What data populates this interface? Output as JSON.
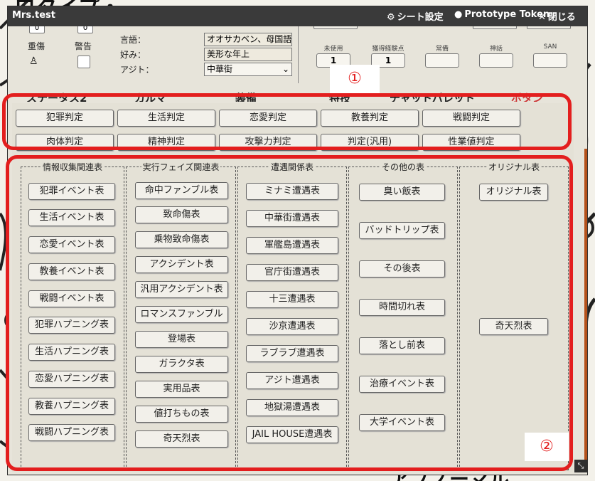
{
  "background": {
    "top_text": "ロタイプ・",
    "bottom_text": "アブノーマル"
  },
  "window": {
    "title": "Mrs.test",
    "sheet_settings_label": "シート設定",
    "prototype_token_label": "Prototype Token",
    "close_label": "閉じる"
  },
  "info": {
    "counter_value_1": "0",
    "counter_value_2": "0",
    "label_injury": "重傷",
    "label_warning": "警告",
    "language_label": "言語：",
    "language_value": "オオサカベン、母国語",
    "likes_label": "好み：",
    "likes_value": "美形な年上",
    "hideout_label": "アジト：",
    "hideout_value": "中華街",
    "stats": [
      {
        "label": "未使用",
        "value": "1"
      },
      {
        "label": "獲得経験点",
        "value": "1"
      },
      {
        "label": "常備",
        "value": ""
      },
      {
        "label": "神話",
        "value": ""
      },
      {
        "label": "SAN",
        "value": ""
      }
    ]
  },
  "tabs": [
    "ステータス2",
    "カルマ",
    "装備",
    "特技",
    "チャットパレット",
    "ボタン"
  ],
  "markers": {
    "one": "①",
    "two": "②"
  },
  "judgments": {
    "row1": [
      "犯罪判定",
      "生活判定",
      "恋愛判定",
      "教養判定",
      "戦闘判定"
    ],
    "row2": [
      "肉体判定",
      "精神判定",
      "攻撃力判定",
      "判定(汎用)",
      "性業値判定"
    ]
  },
  "tables": {
    "columns": [
      {
        "title": "情報収集関連表",
        "items": [
          "犯罪イベント表",
          "生活イベント表",
          "恋愛イベント表",
          "教養イベント表",
          "戦闘イベント表",
          "犯罪ハプニング表",
          "生活ハプニング表",
          "恋愛ハプニング表",
          "教養ハプニング表",
          "戦闘ハプニング表"
        ]
      },
      {
        "title": "実行フェイズ関連表",
        "items": [
          "命中ファンブル表",
          "致命傷表",
          "乗物致命傷表",
          "アクシデント表",
          "汎用アクシデント表",
          "ロマンスファンブル",
          "登場表",
          "ガラクタ表",
          "実用品表",
          "値打ちもの表",
          "奇天烈表"
        ]
      },
      {
        "title": "遭遇関係表",
        "items": [
          "ミナミ遭遇表",
          "中華街遭遇表",
          "軍艦島遭遇表",
          "官庁街遭遇表",
          "十三遭遇表",
          "沙京遭遇表",
          "ラブラブ遭遇表",
          "アジト遭遇表",
          "地獄湯遭遇表",
          "JAIL HOUSE遭遇表"
        ]
      },
      {
        "title": "その他の表",
        "items": [
          "臭い飯表",
          "バッドトリップ表",
          "その後表",
          "時間切れ表",
          "落とし前表",
          "治療イベント表",
          "大学イベント表"
        ]
      },
      {
        "title": "オリジナル表",
        "items": [
          "オリジナル表",
          "奇天烈表"
        ]
      }
    ]
  },
  "colors": {
    "annotation": "#e31e1e",
    "titlebar": "#3a3a3a",
    "scrollbar": "#b5521b"
  }
}
